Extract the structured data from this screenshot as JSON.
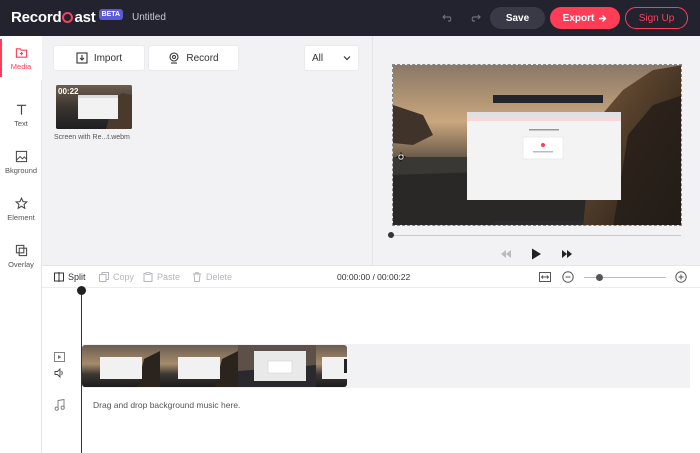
{
  "header": {
    "brand_left": "Record",
    "brand_right": "ast",
    "badge": "BETA",
    "doc_title": "Untitled",
    "save_label": "Save",
    "export_label": "Export",
    "signup_label": "Sign Up"
  },
  "sidebar": {
    "items": [
      {
        "label": "Media",
        "icon": "media-icon",
        "active": true
      },
      {
        "label": "Text",
        "icon": "text-icon"
      },
      {
        "label": "Bkground",
        "icon": "background-icon"
      },
      {
        "label": "Element",
        "icon": "star-icon"
      },
      {
        "label": "Overlay",
        "icon": "overlay-icon"
      }
    ]
  },
  "media": {
    "import_label": "Import",
    "record_label": "Record",
    "filter_value": "All",
    "items": [
      {
        "duration": "00:22",
        "name": "Screen with Re...t.webm"
      }
    ]
  },
  "timeline": {
    "split_label": "Split",
    "copy_label": "Copy",
    "paste_label": "Paste",
    "delete_label": "Delete",
    "time_readout": "00:00:00 / 00:00:22",
    "audio_placeholder": "Drag and drop background music here."
  },
  "colors": {
    "accent": "#ff3d57",
    "topbar": "#23232f",
    "badge": "#5b5bd6"
  }
}
